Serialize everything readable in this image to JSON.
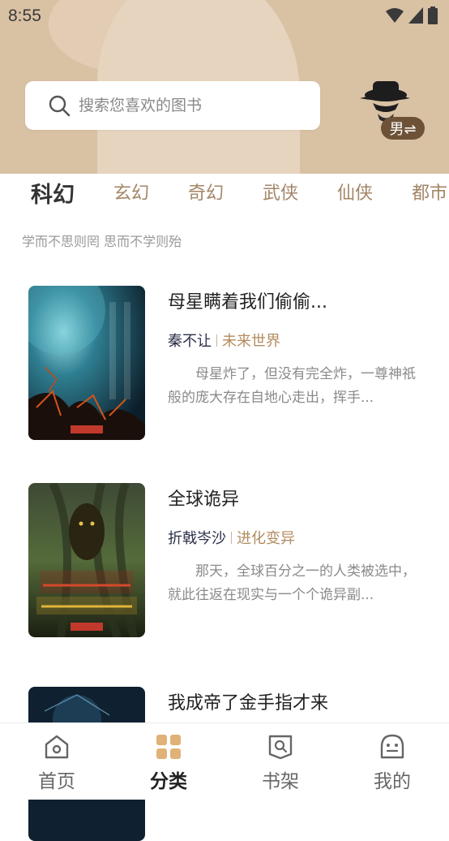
{
  "status": {
    "time": "8:55"
  },
  "search": {
    "placeholder": "搜索您喜欢的图书"
  },
  "profile": {
    "gender_label": "男⇌"
  },
  "tabs": [
    {
      "label": "科幻",
      "active": true
    },
    {
      "label": "玄幻"
    },
    {
      "label": "奇幻"
    },
    {
      "label": "武侠"
    },
    {
      "label": "仙侠"
    },
    {
      "label": "都市"
    }
  ],
  "motto": "学而不思则罔 思而不学则殆",
  "books": [
    {
      "title": "母星瞒着我们偷偷...",
      "author": "秦不让",
      "genre": "未来世界",
      "description": "母星炸了，但没有完全炸，一尊神祇般的庞大存在自地心走出，挥手..."
    },
    {
      "title": "全球诡异",
      "author": "折戟岑沙",
      "genre": "进化变异",
      "description": "那天，全球百分之一的人类被选中，就此往返在现实与一个个诡异副..."
    },
    {
      "title": "我成帝了金手指才来",
      "author": "",
      "genre": "",
      "description": ""
    }
  ],
  "nav": [
    {
      "label": "首页",
      "icon": "home-icon"
    },
    {
      "label": "分类",
      "icon": "category-icon",
      "active": true
    },
    {
      "label": "书架",
      "icon": "bookshelf-icon"
    },
    {
      "label": "我的",
      "icon": "profile-icon"
    }
  ],
  "colors": {
    "header_bg": "#d9c1a4",
    "accent_brown": "#a38667",
    "genre": "#b38c5f",
    "active_nav": "#d9a86a"
  }
}
